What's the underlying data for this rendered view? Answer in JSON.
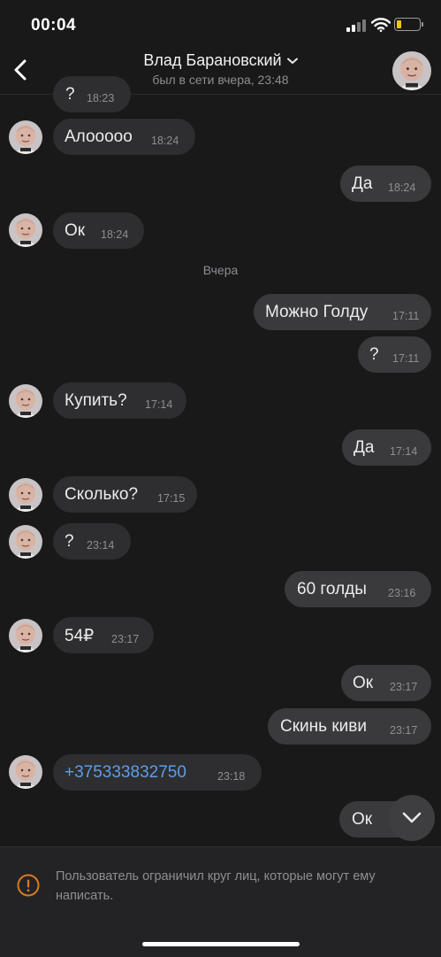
{
  "status_bar": {
    "time": "00:04"
  },
  "header": {
    "contact_name": "Влад Барановский",
    "last_seen": "был в сети вчера, 23:48"
  },
  "messages": [
    {
      "dir": "in",
      "text": "?",
      "time": "18:23"
    },
    {
      "dir": "in",
      "text": "Алооооо",
      "time": "18:24"
    },
    {
      "dir": "out",
      "text": "Да",
      "time": "18:24"
    },
    {
      "dir": "in",
      "text": "Ок",
      "time": "18:24"
    },
    {
      "dir": "out",
      "text": "Можно Голду",
      "time": "17:11"
    },
    {
      "dir": "out",
      "text": "?",
      "time": "17:11"
    },
    {
      "dir": "in",
      "text": "Купить?",
      "time": "17:14"
    },
    {
      "dir": "out",
      "text": "Да",
      "time": "17:14"
    },
    {
      "dir": "in",
      "text": "Сколько?",
      "time": "17:15"
    },
    {
      "dir": "in",
      "text": "?",
      "time": "23:14"
    },
    {
      "dir": "out",
      "text": "60 голды",
      "time": "23:16"
    },
    {
      "dir": "in",
      "text": "54₽",
      "time": "23:17"
    },
    {
      "dir": "out",
      "text": "Ок",
      "time": "23:17"
    },
    {
      "dir": "out",
      "text": "Скинь киви",
      "time": "23:17"
    },
    {
      "dir": "in",
      "text": "+375333832750",
      "time": "23:18",
      "is_link": true
    },
    {
      "dir": "out",
      "text": "Ок",
      "time": ""
    }
  ],
  "date_separator": "Вчера",
  "footer": {
    "notice": "Пользователь ограничил круг лиц, которые могут ему написать."
  },
  "icons": {
    "back": "chevron-left-icon",
    "dropdown": "chevron-down-icon",
    "scroll_down": "chevron-down-icon",
    "warning": "exclamation-circle-icon"
  },
  "colors": {
    "background": "#19191a",
    "incoming_bubble": "#2e2e30",
    "outgoing_bubble": "#3a3a3d",
    "link": "#5c9ee8",
    "warning": "#d9791f",
    "battery": "#f0c419"
  }
}
